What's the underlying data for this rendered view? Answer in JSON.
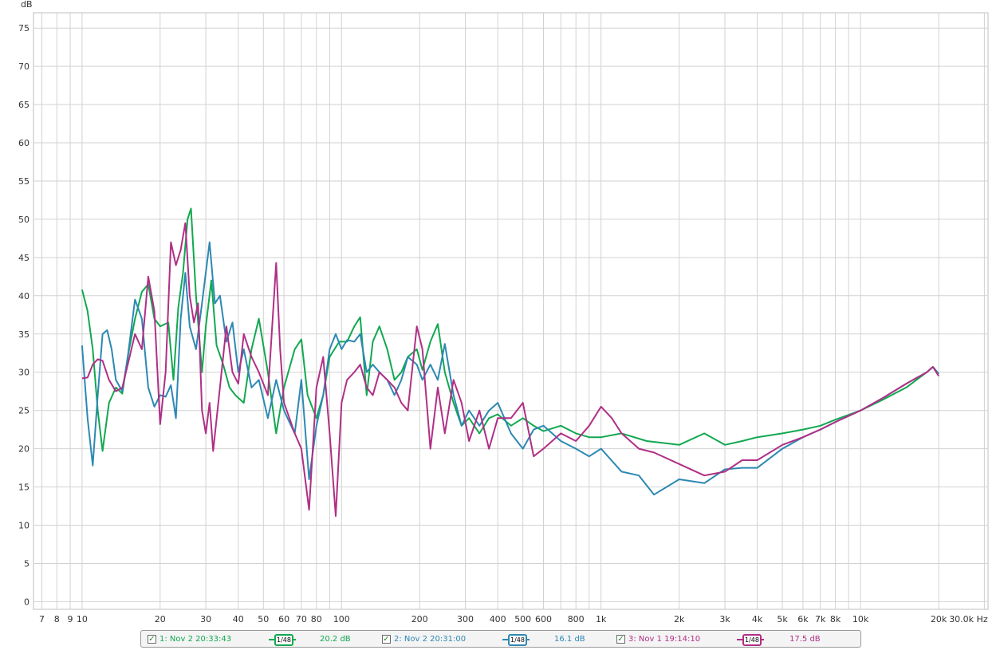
{
  "chart_data": {
    "type": "line",
    "ylabel": "dB",
    "xunit": "Hz",
    "xscale": "log",
    "xlim": [
      6.5,
      31000
    ],
    "ylim": [
      -1,
      77
    ],
    "yticks": [
      0,
      5,
      10,
      15,
      20,
      25,
      30,
      35,
      40,
      45,
      50,
      55,
      60,
      65,
      70,
      75
    ],
    "xticks": [
      {
        "v": 7,
        "label": "7"
      },
      {
        "v": 8,
        "label": "8"
      },
      {
        "v": 9,
        "label": "9"
      },
      {
        "v": 10,
        "label": "10"
      },
      {
        "v": 20,
        "label": "20"
      },
      {
        "v": 30,
        "label": "30"
      },
      {
        "v": 40,
        "label": "40"
      },
      {
        "v": 50,
        "label": "50"
      },
      {
        "v": 60,
        "label": "60"
      },
      {
        "v": 70,
        "label": "70"
      },
      {
        "v": 80,
        "label": "80"
      },
      {
        "v": 100,
        "label": "100"
      },
      {
        "v": 200,
        "label": "200"
      },
      {
        "v": 300,
        "label": "300"
      },
      {
        "v": 400,
        "label": "400"
      },
      {
        "v": 500,
        "label": "500"
      },
      {
        "v": 600,
        "label": "600"
      },
      {
        "v": 800,
        "label": "800"
      },
      {
        "v": 1000,
        "label": "1k"
      },
      {
        "v": 2000,
        "label": "2k"
      },
      {
        "v": 3000,
        "label": "3k"
      },
      {
        "v": 4000,
        "label": "4k"
      },
      {
        "v": 5000,
        "label": "5k"
      },
      {
        "v": 6000,
        "label": "6k"
      },
      {
        "v": 7000,
        "label": "7k"
      },
      {
        "v": 8000,
        "label": "8k"
      },
      {
        "v": 10000,
        "label": "10k"
      },
      {
        "v": 20000,
        "label": "20k"
      },
      {
        "v": 30000,
        "label": "30.0k Hz"
      }
    ],
    "gridlines_x": [
      7,
      8,
      9,
      10,
      20,
      30,
      40,
      50,
      60,
      70,
      80,
      90,
      100,
      200,
      300,
      400,
      500,
      600,
      700,
      800,
      900,
      1000,
      2000,
      3000,
      4000,
      5000,
      6000,
      7000,
      8000,
      9000,
      10000,
      20000,
      30000
    ],
    "grid": true,
    "series": [
      {
        "name": "1: Nov 2 20:33:43",
        "color": "#11a850",
        "smoothing": "1/48",
        "level": "20.2 dB",
        "points": [
          [
            10,
            40.8
          ],
          [
            10.5,
            38
          ],
          [
            11,
            33
          ],
          [
            11.5,
            25
          ],
          [
            12,
            19.7
          ],
          [
            12.7,
            26
          ],
          [
            13.5,
            28
          ],
          [
            14.3,
            27.2
          ],
          [
            15,
            32
          ],
          [
            16,
            37
          ],
          [
            17,
            40.5
          ],
          [
            18,
            41.5
          ],
          [
            19,
            37
          ],
          [
            20,
            36
          ],
          [
            21.5,
            36.5
          ],
          [
            22.5,
            29
          ],
          [
            23.5,
            38.5
          ],
          [
            24.5,
            43
          ],
          [
            25.5,
            50
          ],
          [
            26.3,
            51.4
          ],
          [
            27.5,
            40
          ],
          [
            29,
            30
          ],
          [
            30,
            36
          ],
          [
            31.5,
            42
          ],
          [
            33,
            33.5
          ],
          [
            35,
            31
          ],
          [
            37,
            28
          ],
          [
            39,
            27
          ],
          [
            42,
            26
          ],
          [
            45,
            33
          ],
          [
            48,
            37
          ],
          [
            52,
            30
          ],
          [
            56,
            22
          ],
          [
            60,
            28
          ],
          [
            66,
            33
          ],
          [
            70,
            34.3
          ],
          [
            74,
            27
          ],
          [
            80,
            24
          ],
          [
            85,
            27
          ],
          [
            90,
            32
          ],
          [
            98,
            34
          ],
          [
            105,
            34
          ],
          [
            112,
            36
          ],
          [
            118,
            37.2
          ],
          [
            125,
            27
          ],
          [
            132,
            34
          ],
          [
            140,
            36
          ],
          [
            150,
            33
          ],
          [
            160,
            29
          ],
          [
            170,
            30
          ],
          [
            180,
            32
          ],
          [
            195,
            33
          ],
          [
            205,
            30.3
          ],
          [
            220,
            34
          ],
          [
            235,
            36.3
          ],
          [
            250,
            30
          ],
          [
            270,
            26
          ],
          [
            290,
            23
          ],
          [
            310,
            24
          ],
          [
            340,
            22
          ],
          [
            370,
            24
          ],
          [
            400,
            24.5
          ],
          [
            450,
            23
          ],
          [
            500,
            24
          ],
          [
            550,
            23
          ],
          [
            600,
            22.3
          ],
          [
            700,
            23
          ],
          [
            800,
            22
          ],
          [
            900,
            21.5
          ],
          [
            1000,
            21.5
          ],
          [
            1200,
            22
          ],
          [
            1500,
            21
          ],
          [
            2000,
            20.5
          ],
          [
            2500,
            22
          ],
          [
            3000,
            20.5
          ],
          [
            3500,
            21
          ],
          [
            4000,
            21.5
          ],
          [
            5000,
            22
          ],
          [
            6000,
            22.5
          ],
          [
            7000,
            23
          ],
          [
            8000,
            23.8
          ],
          [
            10000,
            25
          ],
          [
            12000,
            26.3
          ],
          [
            15000,
            28
          ],
          [
            18000,
            30
          ],
          [
            19000,
            30.7
          ],
          [
            20000,
            29.8
          ]
        ]
      },
      {
        "name": "2: Nov 2 20:31:00",
        "color": "#2d88b3",
        "smoothing": "1/48",
        "level": "16.1 dB",
        "points": [
          [
            10,
            33.5
          ],
          [
            10.5,
            24
          ],
          [
            11,
            17.8
          ],
          [
            11.5,
            27
          ],
          [
            12,
            35
          ],
          [
            12.5,
            35.5
          ],
          [
            13,
            33
          ],
          [
            13.5,
            29
          ],
          [
            14.3,
            27.5
          ],
          [
            15,
            32
          ],
          [
            16,
            39.5
          ],
          [
            17,
            37
          ],
          [
            18,
            28
          ],
          [
            19,
            25.5
          ],
          [
            20,
            27
          ],
          [
            21,
            26.8
          ],
          [
            22,
            28.3
          ],
          [
            23,
            24
          ],
          [
            24,
            37
          ],
          [
            25,
            43
          ],
          [
            26,
            36
          ],
          [
            27.5,
            33
          ],
          [
            29,
            39
          ],
          [
            31,
            47
          ],
          [
            32.5,
            39
          ],
          [
            34,
            40
          ],
          [
            36,
            34
          ],
          [
            38,
            36.5
          ],
          [
            40,
            30
          ],
          [
            42,
            33
          ],
          [
            45,
            28
          ],
          [
            48,
            29
          ],
          [
            52,
            24
          ],
          [
            56,
            29
          ],
          [
            60,
            25
          ],
          [
            66,
            22
          ],
          [
            70,
            29
          ],
          [
            75,
            16
          ],
          [
            80,
            23
          ],
          [
            85,
            27
          ],
          [
            90,
            33
          ],
          [
            95,
            35
          ],
          [
            100,
            33
          ],
          [
            105,
            34.2
          ],
          [
            112,
            34
          ],
          [
            118,
            35
          ],
          [
            125,
            30
          ],
          [
            132,
            31
          ],
          [
            140,
            30
          ],
          [
            150,
            29
          ],
          [
            160,
            27
          ],
          [
            170,
            29
          ],
          [
            180,
            32
          ],
          [
            195,
            31
          ],
          [
            205,
            29
          ],
          [
            220,
            31
          ],
          [
            235,
            29
          ],
          [
            250,
            33.7
          ],
          [
            270,
            27
          ],
          [
            290,
            23
          ],
          [
            310,
            25
          ],
          [
            340,
            23
          ],
          [
            370,
            25
          ],
          [
            400,
            26
          ],
          [
            450,
            22
          ],
          [
            500,
            20
          ],
          [
            550,
            22.5
          ],
          [
            600,
            23
          ],
          [
            700,
            21
          ],
          [
            800,
            20
          ],
          [
            900,
            19
          ],
          [
            1000,
            20
          ],
          [
            1200,
            17
          ],
          [
            1400,
            16.5
          ],
          [
            1600,
            14
          ],
          [
            2000,
            16
          ],
          [
            2500,
            15.5
          ],
          [
            3000,
            17.3
          ],
          [
            3500,
            17.5
          ],
          [
            4000,
            17.5
          ],
          [
            5000,
            20
          ],
          [
            6000,
            21.5
          ],
          [
            7000,
            22.5
          ],
          [
            8000,
            23.5
          ],
          [
            10000,
            25
          ],
          [
            12000,
            26.5
          ],
          [
            15000,
            28.5
          ],
          [
            18000,
            30
          ],
          [
            19000,
            30.7
          ],
          [
            20000,
            29.8
          ]
        ]
      },
      {
        "name": "3: Nov 1 19:14:10",
        "color": "#b02f86",
        "smoothing": "1/48",
        "level": "17.5 dB",
        "points": [
          [
            10,
            29.2
          ],
          [
            10.5,
            29.3
          ],
          [
            11,
            31
          ],
          [
            11.5,
            31.7
          ],
          [
            12,
            31.5
          ],
          [
            12.7,
            29
          ],
          [
            13.5,
            27.5
          ],
          [
            14.3,
            28
          ],
          [
            15,
            31
          ],
          [
            16,
            35
          ],
          [
            17,
            33
          ],
          [
            18,
            42.5
          ],
          [
            19,
            38
          ],
          [
            20,
            23.2
          ],
          [
            21,
            30
          ],
          [
            22,
            47
          ],
          [
            23,
            44
          ],
          [
            24,
            46
          ],
          [
            25,
            49.5
          ],
          [
            26,
            40
          ],
          [
            27,
            36.5
          ],
          [
            28,
            39
          ],
          [
            29,
            25
          ],
          [
            30,
            22
          ],
          [
            31,
            26
          ],
          [
            32,
            19.7
          ],
          [
            34,
            28
          ],
          [
            36,
            36
          ],
          [
            38,
            30
          ],
          [
            40,
            28.5
          ],
          [
            42,
            35
          ],
          [
            45,
            32
          ],
          [
            48,
            30
          ],
          [
            52,
            27
          ],
          [
            56,
            44.3
          ],
          [
            58,
            33
          ],
          [
            60,
            26
          ],
          [
            63,
            24
          ],
          [
            66,
            22
          ],
          [
            70,
            20
          ],
          [
            75,
            12
          ],
          [
            80,
            28
          ],
          [
            85,
            32
          ],
          [
            90,
            22
          ],
          [
            95,
            11.2
          ],
          [
            100,
            26
          ],
          [
            105,
            29
          ],
          [
            112,
            30
          ],
          [
            118,
            31
          ],
          [
            125,
            28
          ],
          [
            132,
            27
          ],
          [
            140,
            30
          ],
          [
            150,
            29
          ],
          [
            160,
            28
          ],
          [
            170,
            26
          ],
          [
            180,
            25
          ],
          [
            195,
            36
          ],
          [
            205,
            33
          ],
          [
            220,
            20
          ],
          [
            235,
            28
          ],
          [
            250,
            22
          ],
          [
            270,
            29
          ],
          [
            290,
            26
          ],
          [
            310,
            21
          ],
          [
            340,
            25
          ],
          [
            370,
            20
          ],
          [
            400,
            24
          ],
          [
            450,
            24
          ],
          [
            500,
            26
          ],
          [
            550,
            19
          ],
          [
            600,
            20
          ],
          [
            700,
            22
          ],
          [
            800,
            21
          ],
          [
            900,
            23
          ],
          [
            1000,
            25.5
          ],
          [
            1100,
            24
          ],
          [
            1200,
            22
          ],
          [
            1400,
            20
          ],
          [
            1600,
            19.5
          ],
          [
            2000,
            18
          ],
          [
            2500,
            16.5
          ],
          [
            3000,
            17
          ],
          [
            3500,
            18.5
          ],
          [
            4000,
            18.5
          ],
          [
            5000,
            20.5
          ],
          [
            6000,
            21.5
          ],
          [
            7000,
            22.5
          ],
          [
            8000,
            23.5
          ],
          [
            10000,
            25
          ],
          [
            12000,
            26.5
          ],
          [
            15000,
            28.5
          ],
          [
            18000,
            30
          ],
          [
            19000,
            30.7
          ],
          [
            20000,
            29.5
          ]
        ]
      }
    ]
  },
  "legend": {
    "items": [
      {
        "check": "✓",
        "label": "1: Nov 2 20:33:43",
        "smooth_label": "1/48",
        "level": "20.2 dB",
        "color": "#11a850"
      },
      {
        "check": "✓",
        "label": "2: Nov 2 20:31:00",
        "smooth_label": "1/48",
        "level": "16.1 dB",
        "color": "#2d88b3"
      },
      {
        "check": "✓",
        "label": "3: Nov 1 19:14:10",
        "smooth_label": "1/48",
        "level": "17.5 dB",
        "color": "#b02f86"
      }
    ]
  }
}
